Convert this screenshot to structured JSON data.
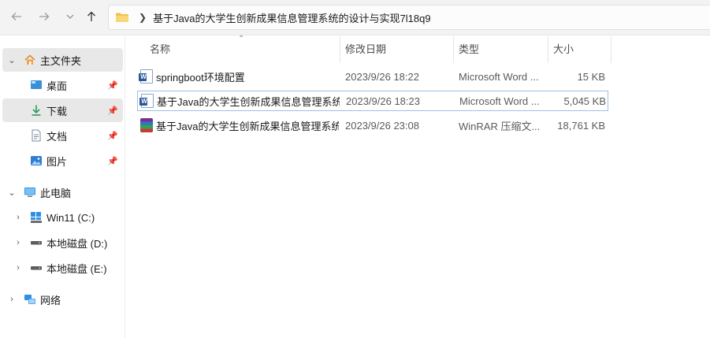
{
  "address_bar": {
    "path": "基于Java的大学生创新成果信息管理系统的设计与实现7l18q9"
  },
  "sidebar": {
    "home": {
      "label": "主文件夹"
    },
    "quick_access": [
      {
        "label": "桌面"
      },
      {
        "label": "下载"
      },
      {
        "label": "文档"
      },
      {
        "label": "图片"
      }
    ],
    "this_pc": {
      "label": "此电脑"
    },
    "drives": [
      {
        "label": "Win11 (C:)"
      },
      {
        "label": "本地磁盘 (D:)"
      },
      {
        "label": "本地磁盘 (E:)"
      }
    ],
    "network": {
      "label": "网络"
    }
  },
  "columns": {
    "name": "名称",
    "modified": "修改日期",
    "type": "类型",
    "size": "大小"
  },
  "files": [
    {
      "name": "springboot环境配置",
      "modified": "2023/9/26 18:22",
      "type": "Microsoft Word ...",
      "size": "15 KB",
      "icon": "word-doc-icon"
    },
    {
      "name": "基于Java的大学生创新成果信息管理系统...",
      "modified": "2023/9/26 18:23",
      "type": "Microsoft Word ...",
      "size": "5,045 KB",
      "icon": "word-doc-icon"
    },
    {
      "name": "基于Java的大学生创新成果信息管理系统...",
      "modified": "2023/9/26 23:08",
      "type": "WinRAR 压缩文...",
      "size": "18,761 KB",
      "icon": "winrar-archive-icon"
    }
  ]
}
